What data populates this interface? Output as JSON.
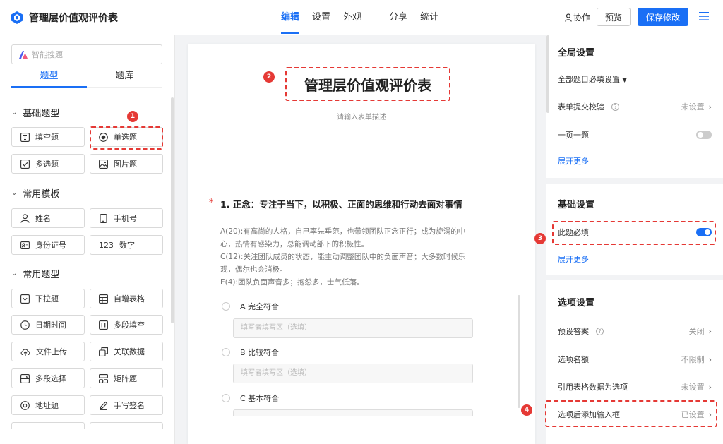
{
  "header": {
    "title": "管理层价值观评价表",
    "nav": [
      {
        "label": "编辑",
        "active": true
      },
      {
        "label": "设置",
        "active": false
      },
      {
        "label": "外观",
        "active": false
      },
      {
        "label": "分享",
        "active": false
      },
      {
        "label": "统计",
        "active": false
      }
    ],
    "collab_label": "协作",
    "preview_label": "预览",
    "save_label": "保存修改",
    "accent_color": "#1a6ff5"
  },
  "left": {
    "search_placeholder": "智能搜题",
    "tabs": [
      "题型",
      "题库"
    ],
    "sections": [
      "基础题型",
      "常用模板",
      "常用题型"
    ],
    "basic": [
      {
        "label": "填空题",
        "icon": "text-input-icon"
      },
      {
        "label": "单选题",
        "icon": "radio-icon"
      },
      {
        "label": "多选题",
        "icon": "checkbox-icon"
      },
      {
        "label": "图片题",
        "icon": "image-icon"
      }
    ],
    "templates": [
      {
        "label": "姓名",
        "icon": "person-icon"
      },
      {
        "label": "手机号",
        "icon": "phone-icon"
      },
      {
        "label": "身份证号",
        "icon": "id-card-icon"
      },
      {
        "label": "数字",
        "icon": "number-icon",
        "prefix": "123"
      }
    ],
    "common": [
      {
        "label": "下拉题",
        "icon": "dropdown-icon"
      },
      {
        "label": "自增表格",
        "icon": "table-icon"
      },
      {
        "label": "日期时间",
        "icon": "clock-icon"
      },
      {
        "label": "多段填空",
        "icon": "multi-fill-icon"
      },
      {
        "label": "文件上传",
        "icon": "upload-icon"
      },
      {
        "label": "关联数据",
        "icon": "link-data-icon"
      },
      {
        "label": "多段选择",
        "icon": "multi-select-icon"
      },
      {
        "label": "矩阵题",
        "icon": "matrix-icon"
      },
      {
        "label": "地址题",
        "icon": "location-icon"
      },
      {
        "label": "手写签名",
        "icon": "signature-icon"
      }
    ]
  },
  "form": {
    "title": "管理层价值观评价表",
    "description": "请输入表单描述",
    "question": {
      "title": "1. 正念：专注于当下，以积极、正面的思维和行动去面对事情",
      "description_lines": [
        "A(20):有高尚的人格，自己率先垂范，也带领团队正念正行；成为旋涡的中",
        "心，热情有感染力，总能调动部下的积极性。",
        "C(12):关注团队成员的状态，能主动调整团队中的负面声音；大多数时候乐",
        "观，偶尔也会消极。",
        "E(4):团队负面声音多；抱怨多，士气低落。"
      ],
      "options": [
        "A 完全符合",
        "B 比较符合",
        "C 基本符合"
      ],
      "option_input_placeholder": "填写者填写区（选填）"
    }
  },
  "right": {
    "global": {
      "title": "全局设置",
      "all_required": "全部题目必填设置",
      "submit_check": "表单提交校验",
      "submit_check_value": "未设置",
      "one_per_page": "一页一题",
      "expand": "展开更多"
    },
    "basic": {
      "title": "基础设置",
      "required": "此题必填",
      "expand": "展开更多"
    },
    "options": {
      "title": "选项设置",
      "rows": [
        {
          "label": "预设答案",
          "value": "关闭",
          "help": true
        },
        {
          "label": "选项名额",
          "value": "不限制",
          "help": false
        },
        {
          "label": "引用表格数据为选项",
          "value": "未设置",
          "help": false
        },
        {
          "label": "选项后添加输入框",
          "value": "已设置",
          "help": false
        }
      ]
    }
  },
  "annotations": [
    "1",
    "2",
    "3",
    "4"
  ]
}
